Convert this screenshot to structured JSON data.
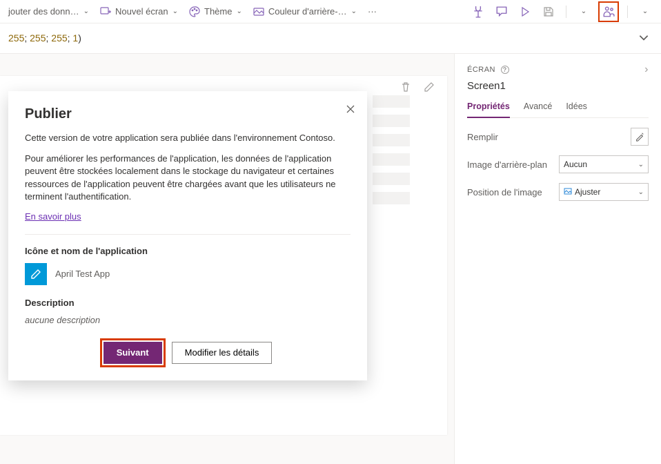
{
  "toolbar": {
    "add_data": "jouter des donn…",
    "new_screen": "Nouvel écran",
    "theme": "Thème",
    "bg_color": "Couleur d'arrière-…"
  },
  "formula": {
    "n1": "255",
    "n2": "255",
    "n3": "255",
    "n4": "1"
  },
  "dialog": {
    "title": "Publier",
    "line1": "Cette version de votre application sera publiée dans l'environnement Contoso.",
    "line2": "Pour améliorer les performances de l'application, les données de l'application peuvent être stockées localement dans le stockage du navigateur et certaines ressources de l'application peuvent être chargées avant que les utilisateurs ne terminent l'authentification.",
    "learn_more": "En savoir plus",
    "icon_name_label": "Icône et nom de l'application",
    "app_name": "April Test App",
    "description_label": "Description",
    "description_none": "aucune description",
    "next": "Suivant",
    "edit_details": "Modifier les détails"
  },
  "panel": {
    "breadcrumb": "ÉCRAN",
    "screen_title": "Screen1",
    "tabs": {
      "properties": "Propriétés",
      "advanced": "Avancé",
      "ideas": "Idées"
    },
    "rows": {
      "fill": "Remplir",
      "bg_image": "Image d'arrière-plan",
      "bg_image_value": "Aucun",
      "img_position": "Position de l'image",
      "img_position_value": "Ajuster"
    }
  }
}
